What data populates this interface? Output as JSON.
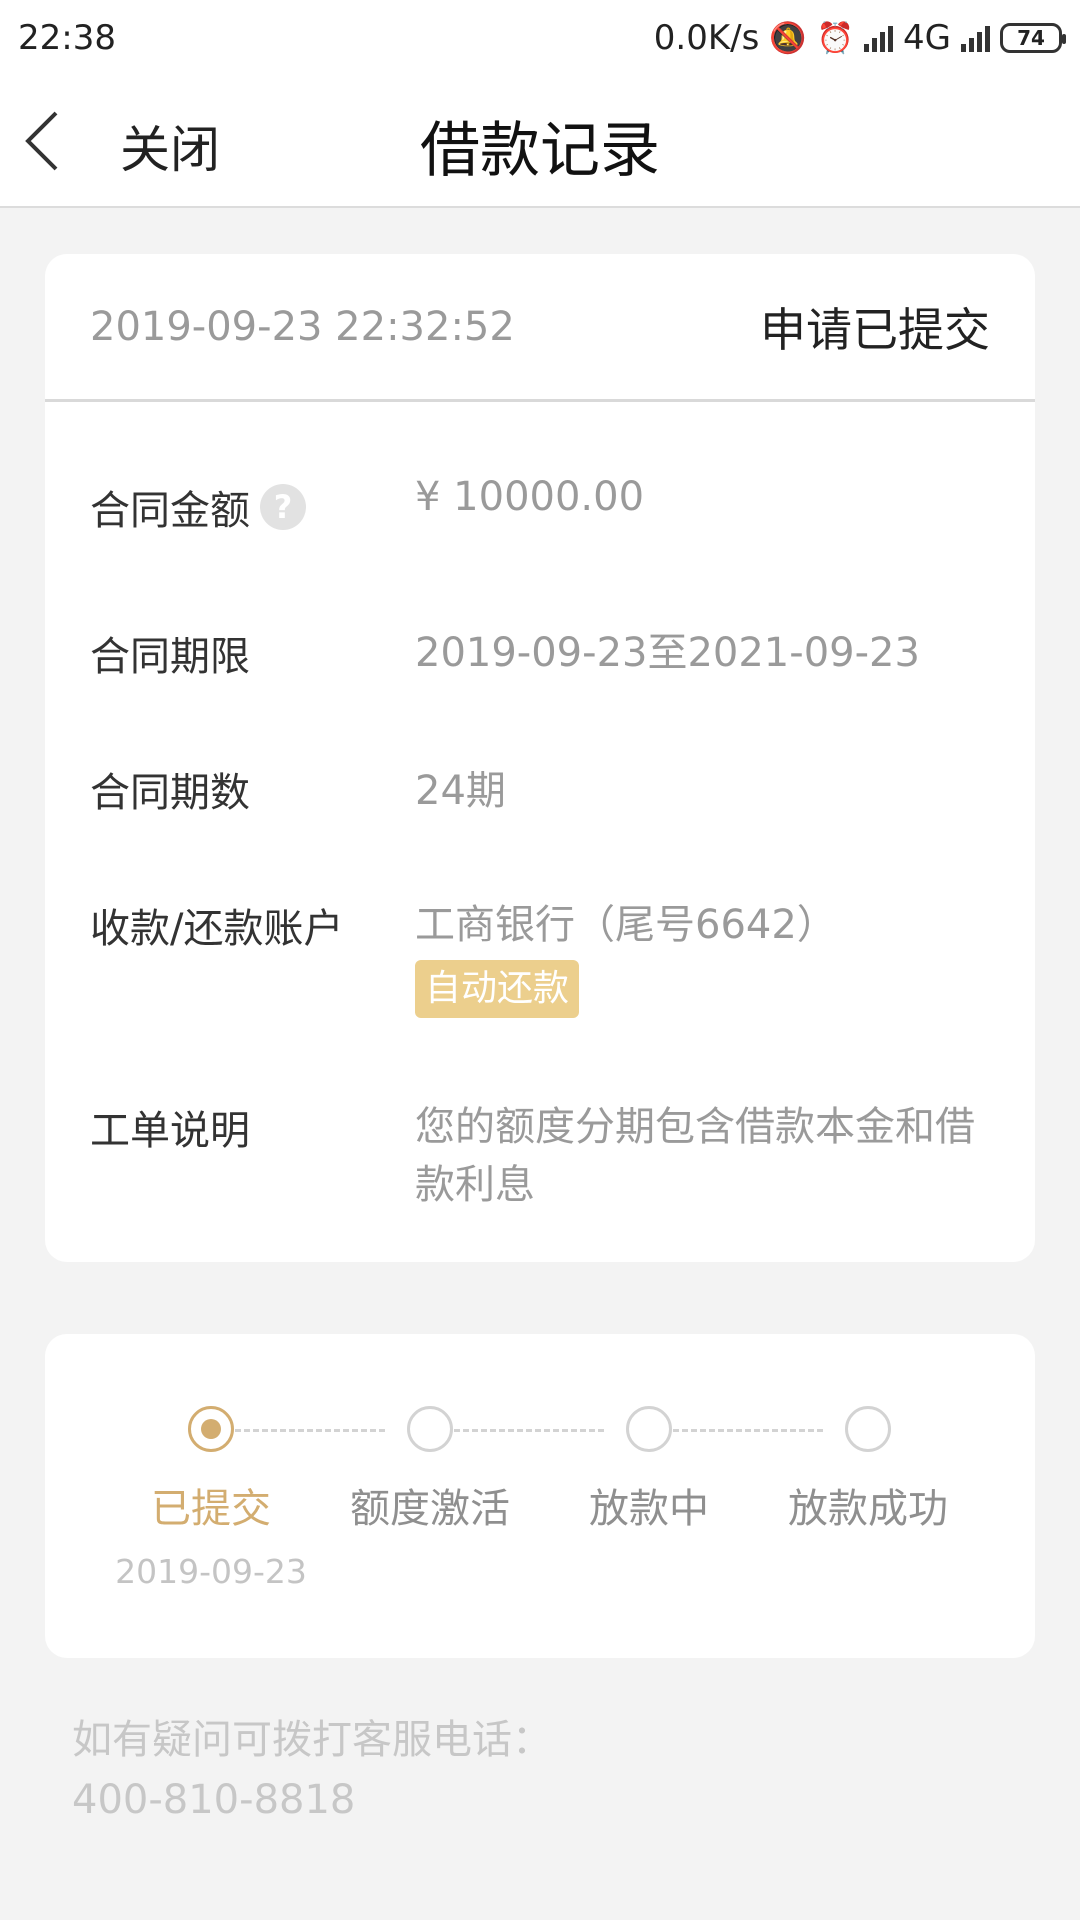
{
  "status_bar": {
    "time": "22:38",
    "net_speed": "0.0K/s",
    "network": "4G",
    "battery": "74",
    "icons": [
      "mute-bell-icon",
      "alarm-icon",
      "hd-signal-icon",
      "signal-icon"
    ]
  },
  "nav": {
    "close_label": "关闭",
    "title": "借款记录"
  },
  "detail": {
    "datetime": "2019-09-23 22:32:52",
    "status": "申请已提交",
    "rows": [
      {
        "label": "合同金额",
        "value": "¥ 10000.00"
      },
      {
        "label": "合同期限",
        "value": "2019-09-23至2021-09-23"
      },
      {
        "label": "合同期数",
        "value": "24期"
      },
      {
        "label": "收款/还款账户",
        "value": "工商银行（尾号6642）",
        "badge": "自动还款"
      },
      {
        "label": "工单说明",
        "value": "您的额度分期包含借款本金和借款利息"
      }
    ]
  },
  "progress": {
    "steps": [
      {
        "label": "已提交",
        "date": "2019-09-23",
        "active": true
      },
      {
        "label": "额度激活",
        "date": "",
        "active": false
      },
      {
        "label": "放款中",
        "date": "",
        "active": false
      },
      {
        "label": "放款成功",
        "date": "",
        "active": false
      }
    ]
  },
  "footer": {
    "line1": "如有疑问可拨打客服电话：",
    "phone": "400-810-8818"
  },
  "colors": {
    "accent": "#d3ad70",
    "badge": "#eccf8d",
    "background": "#f3f3f3"
  }
}
